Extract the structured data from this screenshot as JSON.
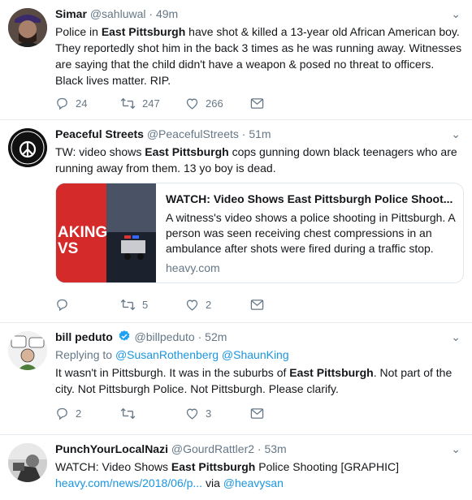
{
  "tweets": [
    {
      "name": "Simar",
      "handle": "@sahluwal",
      "dot": "·",
      "time": "49m",
      "text_parts": [
        {
          "t": "Police in "
        },
        {
          "t": "East Pittsburgh",
          "b": true
        },
        {
          "t": " have shot & killed a 13-year old African American boy. They reportedly shot him in the back 3 times as he was running away. Witnesses are saying that the child didn't have a weapon & posed no threat to officers. Black lives matter. RIP."
        }
      ],
      "replies": "24",
      "retweets": "247",
      "likes": "266"
    },
    {
      "name": "Peaceful Streets",
      "handle": "@PeacefulStreets",
      "dot": "·",
      "time": "51m",
      "text_parts": [
        {
          "t": "TW: video shows "
        },
        {
          "t": "East Pittsburgh",
          "b": true
        },
        {
          "t": " cops gunning down black teenagers who are running away from them. 13 yo boy is dead."
        }
      ],
      "card": {
        "title": "WATCH: Video Shows East Pittsburgh Police Shoot...",
        "desc": "A witness's video shows a police shooting in Pittsburgh. A person was seen receiving chest compressions in an ambulance after shots were fired during a traffic stop.",
        "domain": "heavy.com",
        "image_text": "AKING\nVS"
      },
      "replies": "",
      "retweets": "5",
      "likes": "2"
    },
    {
      "name": "bill peduto",
      "handle": "@billpeduto",
      "dot": "·",
      "time": "52m",
      "replying_label": "Replying to",
      "replying_to": [
        "@SusanRothenberg",
        "@ShaunKing"
      ],
      "text_parts": [
        {
          "t": "It wasn't in Pittsburgh. It was in the suburbs of "
        },
        {
          "t": "East Pittsburgh",
          "b": true
        },
        {
          "t": ". Not part of the city. Not Pittsburgh Police. Not Pittsburgh. Please clarify."
        }
      ],
      "replies": "2",
      "retweets": "",
      "likes": "3"
    },
    {
      "name": "PunchYourLocalNazi",
      "handle": "@GourdRattler2",
      "dot": "·",
      "time": "53m",
      "text_parts": [
        {
          "t": "WATCH: Video Shows "
        },
        {
          "t": "East Pittsburgh",
          "b": true
        },
        {
          "t": " Police Shooting [GRAPHIC]"
        }
      ],
      "link_line": {
        "url": "heavy.com/news/2018/06/p...",
        "via": " via ",
        "mention": "@heavysan"
      }
    }
  ],
  "colors": {
    "accent": "#1b95e0",
    "muted": "#657786",
    "border": "#e6ecf0"
  },
  "icons": {
    "reply": "reply-icon",
    "retweet": "retweet-icon",
    "like": "heart-icon",
    "dm": "envelope-icon",
    "caret": "chevron-down-icon",
    "verified": "verified-badge-icon"
  }
}
